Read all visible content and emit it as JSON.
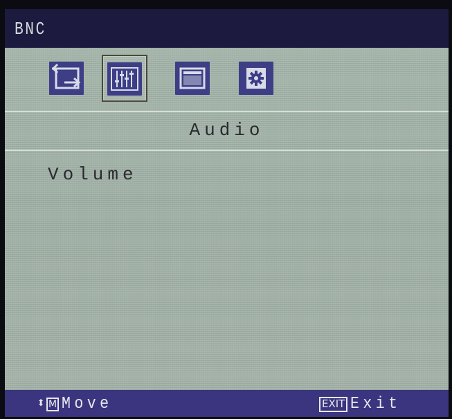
{
  "window": {
    "title": "BNC"
  },
  "tabs": [
    {
      "icon": "input-source-icon",
      "selected": false
    },
    {
      "icon": "equalizer-icon",
      "selected": true
    },
    {
      "icon": "display-window-icon",
      "selected": false
    },
    {
      "icon": "settings-gear-icon",
      "selected": false
    }
  ],
  "section": {
    "title": "Audio"
  },
  "menu": {
    "items": [
      {
        "label": "Volume"
      }
    ]
  },
  "footer": {
    "move_key": "M",
    "move_label": "Move",
    "exit_key": "EXIT",
    "exit_label": "Exit"
  },
  "colors": {
    "title_bar": "#1c1a3e",
    "footer_bar": "#3a357e",
    "panel": "#a7b5ab",
    "icon_box": "#3d3e86"
  }
}
